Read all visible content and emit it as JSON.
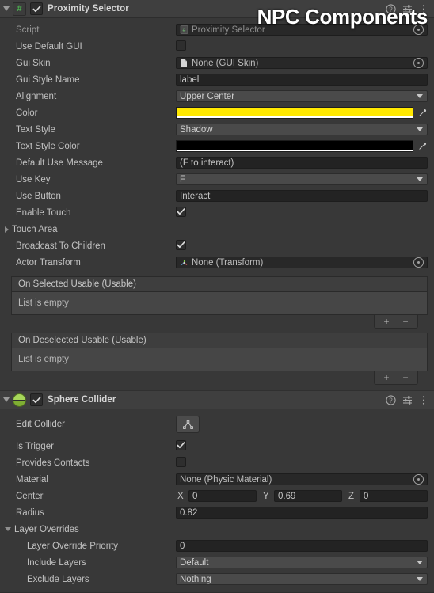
{
  "watermark": "NPC Components",
  "components": [
    {
      "title": "Proximity Selector",
      "icon": "csharp-script-icon",
      "enabled_checkbox": true,
      "help_icon": "help-icon",
      "preset_icon": "preset-icon",
      "menu_icon": "kebab-menu-icon",
      "rows": [
        {
          "label": "Script",
          "type": "object",
          "value": "Proximity Selector",
          "icon": "script-asset-icon",
          "dim": true
        },
        {
          "label": "Use Default GUI",
          "type": "checkbox",
          "checked": false
        },
        {
          "label": "Gui Skin",
          "type": "object",
          "value": "None (GUI Skin)",
          "icon": "asset-file-icon"
        },
        {
          "label": "Gui Style Name",
          "type": "text",
          "value": "label"
        },
        {
          "label": "Alignment",
          "type": "dropdown",
          "value": "Upper Center"
        },
        {
          "label": "Color",
          "type": "color",
          "value": "#FFE800"
        },
        {
          "label": "Text Style",
          "type": "dropdown",
          "value": "Shadow"
        },
        {
          "label": "Text Style Color",
          "type": "color",
          "value": "#000000"
        },
        {
          "label": "Default Use Message",
          "type": "text",
          "value": "(F to interact)"
        },
        {
          "label": "Use Key",
          "type": "dropdown",
          "value": "F"
        },
        {
          "label": "Use Button",
          "type": "text",
          "value": "Interact"
        },
        {
          "label": "Enable Touch",
          "type": "checkbox",
          "checked": true
        },
        {
          "label": "Touch Area",
          "type": "foldout",
          "expanded": false
        },
        {
          "label": "Broadcast To Children",
          "type": "checkbox",
          "checked": true
        },
        {
          "label": "Actor Transform",
          "type": "object",
          "value": "None (Transform)",
          "icon": "transform-icon"
        }
      ],
      "lists": [
        {
          "header": "On Selected Usable (Usable)",
          "empty_text": "List is empty",
          "add_label": "+",
          "remove_label": "−"
        },
        {
          "header": "On Deselected Usable (Usable)",
          "empty_text": "List is empty",
          "add_label": "+",
          "remove_label": "−"
        }
      ]
    },
    {
      "title": "Sphere Collider",
      "icon": "sphere-collider-icon",
      "enabled_checkbox": true,
      "help_icon": "help-icon",
      "preset_icon": "preset-icon",
      "menu_icon": "kebab-menu-icon",
      "edit_collider": {
        "label": "Edit Collider",
        "button_icon": "edit-collider-icon"
      },
      "rows": [
        {
          "label": "Is Trigger",
          "type": "checkbox",
          "checked": true
        },
        {
          "label": "Provides Contacts",
          "type": "checkbox",
          "checked": false
        },
        {
          "label": "Material",
          "type": "object",
          "value": "None (Physic Material)"
        },
        {
          "label": "Center",
          "type": "vector3",
          "axes": [
            "X",
            "Y",
            "Z"
          ],
          "values": [
            "0",
            "0.69",
            "0"
          ]
        },
        {
          "label": "Radius",
          "type": "text",
          "value": "0.82"
        },
        {
          "label": "Layer Overrides",
          "type": "foldout",
          "expanded": true
        },
        {
          "label": "Layer Override Priority",
          "type": "text",
          "value": "0",
          "indent": 2
        },
        {
          "label": "Include Layers",
          "type": "dropdown",
          "value": "Default",
          "indent": 2
        },
        {
          "label": "Exclude Layers",
          "type": "dropdown",
          "value": "Nothing",
          "indent": 2
        }
      ]
    }
  ]
}
